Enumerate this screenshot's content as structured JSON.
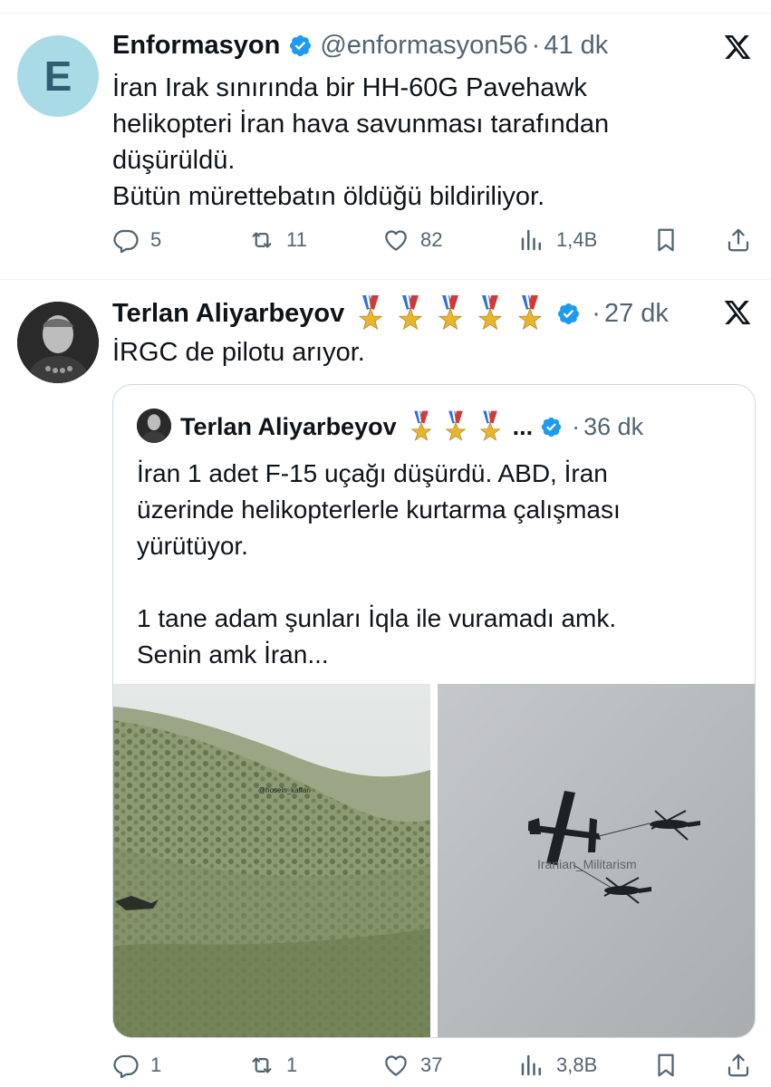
{
  "tweet1": {
    "display_name": "Enformasyon",
    "handle": "@enformasyon56",
    "separator": "·",
    "time": "41 dk",
    "avatar_letter": "E",
    "lines": [
      "İran Irak sınırında bir HH-60G Pavehawk",
      "helikopteri İran hava savunması tarafından",
      "düşürüldü.",
      "Bütün mürettebatın öldüğü bildiriliyor."
    ],
    "replies": "5",
    "reposts": "11",
    "likes": "82",
    "views": "1,4B"
  },
  "tweet2": {
    "display_name": "Terlan Aliyarbeyov",
    "separator": "·",
    "time": "27 dk",
    "medal_count": 5,
    "lines": [
      "İRGC de pilotu arıyor."
    ],
    "replies": "1",
    "reposts": "1",
    "likes": "37",
    "views": "3,8B",
    "quoted": {
      "display_name": "Terlan Aliyarbeyov",
      "truncation": "...",
      "separator": "·",
      "time": "36 dk",
      "lines": [
        "İran 1 adet F-15 uçağı düşürdü. ABD, İran",
        "üzerinde helikopterlerle kurtarma çalışması",
        "yürütüyor.",
        "",
        "1 tane adam şunları İqla ile vuramadı amk.",
        "Senin amk İran..."
      ],
      "media": [
        {
          "watermark": "@hosein_kaffari"
        },
        {
          "watermark": "Iranian_Militarism"
        }
      ]
    }
  },
  "colors": {
    "verified_blue": "#1d9bf0",
    "muted_text": "#536471",
    "divider": "#eff3f4",
    "avatar_bg": "#a8dbe6"
  },
  "icons": [
    "reply-icon",
    "repost-icon",
    "like-icon",
    "views-icon",
    "bookmark-icon",
    "share-icon",
    "x-logo-icon",
    "verified-badge-icon",
    "medal-icon"
  ]
}
